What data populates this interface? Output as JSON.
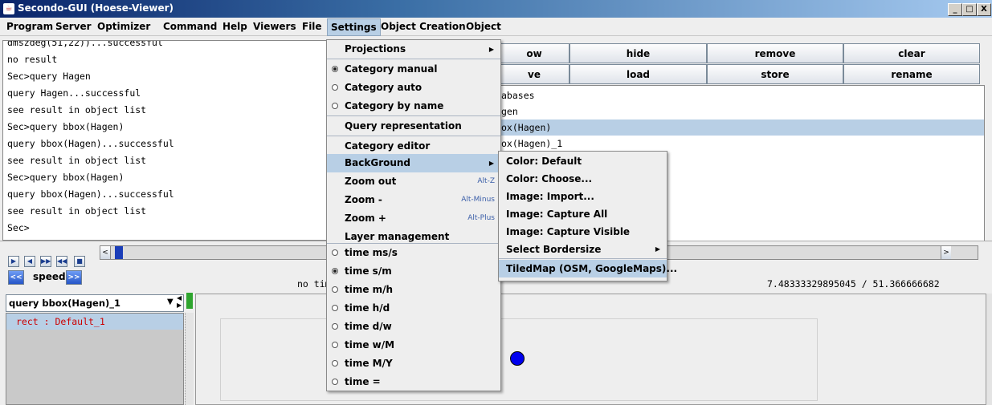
{
  "window": {
    "title": "Secondo-GUI (Hoese-Viewer)",
    "controls": [
      "_",
      "□",
      "X"
    ]
  },
  "menubar": {
    "items": [
      "Program",
      "Server",
      "Optimizer",
      "Command",
      "Help",
      "Viewers",
      "File",
      "Settings",
      "Object Creation",
      "Object"
    ],
    "active": "Settings"
  },
  "console": {
    "lines": [
      "dmszdeg(51,22))...successful",
      "no result",
      "Sec>query Hagen",
      "query Hagen...successful",
      "see result in object list",
      "Sec>query bbox(Hagen)",
      "query bbox(Hagen)...successful",
      "see result in object list",
      "Sec>query bbox(Hagen)",
      "query bbox(Hagen)...successful",
      "see result in object list",
      "Sec>"
    ]
  },
  "toolbar": {
    "row1": [
      "ow",
      "hide",
      "remove",
      "clear"
    ],
    "row2": [
      "ve",
      "load",
      "store",
      "rename"
    ]
  },
  "object_list": {
    "items": [
      "abases",
      "gen",
      "ox(Hagen)",
      "ox(Hagen)_1"
    ],
    "selected_index": 2
  },
  "timebar": {
    "speed_label": "speed",
    "time_text": "no tim",
    "coordinates": "7.48333329895045 / 51.366666682",
    "slider_value": 0
  },
  "bottom": {
    "query_combo_value": "query bbox(Hagen)_1",
    "category_item": "rect : Default_1"
  },
  "settings_menu": {
    "items": [
      {
        "label": "Projections",
        "type": "submenu"
      },
      {
        "label": "Category manual",
        "type": "radio",
        "checked": true
      },
      {
        "label": "Category auto",
        "type": "radio",
        "checked": false
      },
      {
        "label": "Category by name",
        "type": "radio",
        "checked": false
      },
      {
        "label": "Query representation",
        "type": "item"
      },
      {
        "label": "Category editor",
        "type": "item"
      },
      {
        "label": "BackGround",
        "type": "submenu",
        "highlighted": true
      },
      {
        "label": "Zoom out",
        "type": "item",
        "shortcut": "Alt-Z"
      },
      {
        "label": "Zoom -",
        "type": "item",
        "shortcut": "Alt-Minus"
      },
      {
        "label": "Zoom +",
        "type": "item",
        "shortcut": "Alt-Plus"
      },
      {
        "label": "Layer management",
        "type": "item"
      },
      {
        "label": "time ms/s",
        "type": "radio",
        "checked": false
      },
      {
        "label": "time s/m",
        "type": "radio",
        "checked": true
      },
      {
        "label": "time m/h",
        "type": "radio",
        "checked": false
      },
      {
        "label": "time h/d",
        "type": "radio",
        "checked": false
      },
      {
        "label": "time d/w",
        "type": "radio",
        "checked": false
      },
      {
        "label": "time w/M",
        "type": "radio",
        "checked": false
      },
      {
        "label": "time M/Y",
        "type": "radio",
        "checked": false
      },
      {
        "label": "time =",
        "type": "radio",
        "checked": false
      }
    ]
  },
  "background_submenu": {
    "items": [
      {
        "label": "Color: Default"
      },
      {
        "label": "Color: Choose..."
      },
      {
        "label": "Image: Import..."
      },
      {
        "label": "Image: Capture All"
      },
      {
        "label": "Image: Capture Visible"
      },
      {
        "label": "Select Bordersize",
        "type": "submenu"
      },
      {
        "label": "TiledMap (OSM, GoogleMaps)...",
        "highlighted": true
      }
    ]
  },
  "colors": {
    "titlebar_start": "#0a246a",
    "highlight": "#b8cfe5",
    "point": "#0000ee",
    "category_text": "#cc0000"
  }
}
